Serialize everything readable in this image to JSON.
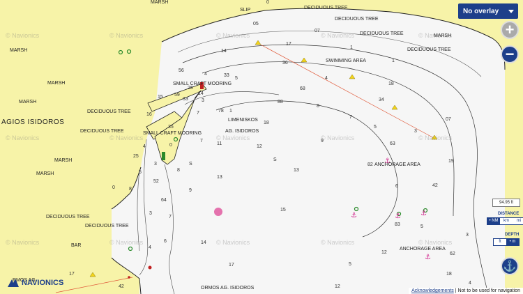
{
  "map": {
    "place_labels": {
      "agios_isidoros": "AGIOS ISIDOROS",
      "marsh": "MARSH",
      "deciduous_tree": "DECIDUOUS TREE",
      "slip": "SLIP",
      "swimming_area": "SWIMMING AREA",
      "small_craft_mooring": "SMALL CRAFT MOORING",
      "limeniskos": "LIMENISKOS",
      "ag_isidoros": "AG. ISIDOROS",
      "anchorage_area": "ANCHORAGE AREA",
      "bar": "BAR",
      "ormos": "ORMOS AG. ISIDOROS",
      "ormos_partial": "RMOS AG."
    },
    "watermark": "© Navionics",
    "depths": [
      "05",
      "07",
      "0",
      "1",
      "14",
      "17",
      "36",
      "1",
      "56",
      "4",
      "33",
      "5",
      "59",
      "26",
      "33",
      "4",
      "68",
      "34",
      "18",
      "15",
      "14",
      "3",
      "88",
      "8",
      "78",
      "7",
      "7",
      "07",
      "18",
      "3",
      "5",
      "1",
      "16",
      "35",
      "7",
      "11",
      "12",
      "63",
      "4",
      "0",
      "9",
      "25",
      "3",
      "19",
      "5",
      "S",
      "S",
      "13",
      "8",
      "82",
      "52",
      "13",
      "42",
      "6",
      "9",
      "64",
      "0",
      "8",
      "15",
      "83",
      "3",
      "5",
      "7",
      "14",
      "17",
      "12",
      "6",
      "5",
      "12",
      "17",
      "62",
      "3",
      "42",
      "4",
      "18",
      "4"
    ],
    "colors": {
      "land": "#f7f3a8",
      "water": "#f6f6f6",
      "contour": "#222222",
      "route": "#e05a3a",
      "buoy": "#f3d41a",
      "anchorage": "#d0208a",
      "marker_green": "#2a8a2a"
    }
  },
  "controls": {
    "overlay_select": "No overlay",
    "zoom_in": "+",
    "zoom_out": "−",
    "scale_value": "94.95 ft",
    "distance_label": "DISTANCE",
    "distance_units": [
      "• NM",
      "km",
      "mi"
    ],
    "depth_label": "DEPTH",
    "depth_units": [
      "ft",
      "• m"
    ],
    "anchor_icon": "anchor-icon"
  },
  "branding": {
    "logo_text": "NAVIONICS",
    "footer_link": "Acknowledgements",
    "footer_text": "| Not to be used for navigation"
  }
}
